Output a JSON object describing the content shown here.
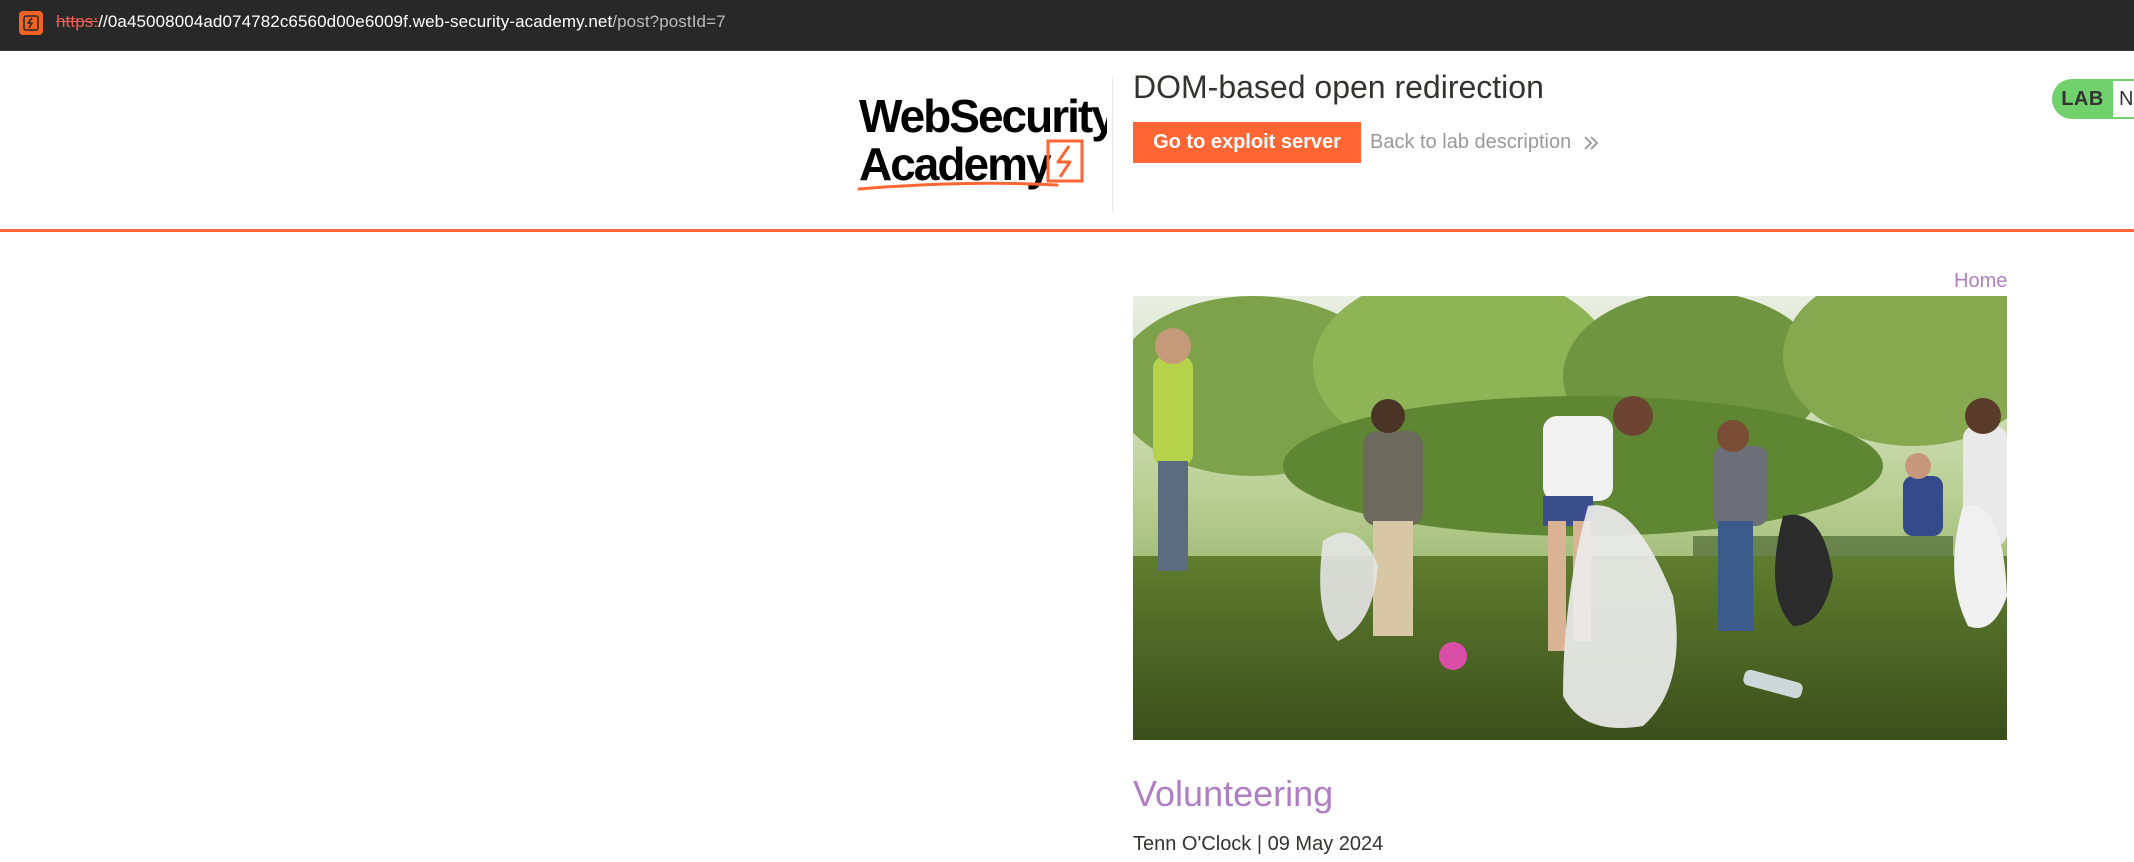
{
  "browser": {
    "url_scheme": "https:",
    "url_host": "//0a45008004ad074782c6560d00e6009f.web-security-academy.net",
    "url_path": "/post?postId=7",
    "site_icon": "portswigger-favicon-icon"
  },
  "header": {
    "logo_line1": "WebSecurity",
    "logo_line2": "Academy",
    "lab_title": "DOM-based open redirection",
    "exploit_button": "Go to exploit server",
    "back_link": "Back to lab description",
    "lab_badge": "LAB",
    "lab_status": "N",
    "accent_color": "#ff6633",
    "badge_color": "#70d16d"
  },
  "nav": {
    "home": "Home"
  },
  "post": {
    "title": "Volunteering",
    "meta": "Tenn O'Clock | 09 May 2024",
    "image_description_icon": "volunteers-photo"
  }
}
